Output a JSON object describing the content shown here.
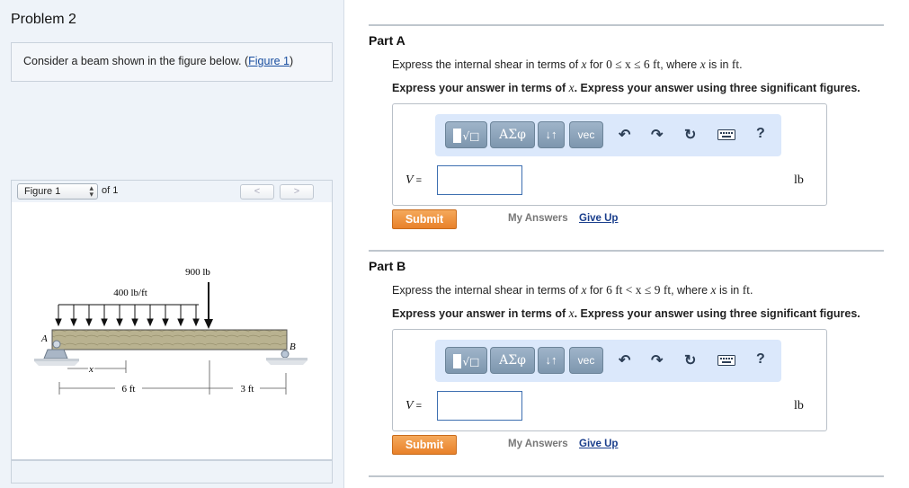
{
  "problem": {
    "title": "Problem 2",
    "prompt_text": "Consider a beam shown in the figure below. (",
    "prompt_link": "Figure 1",
    "prompt_close": ")"
  },
  "figure_nav": {
    "selected": "Figure 1",
    "of_text": "of 1",
    "prev": "<",
    "next": ">"
  },
  "figure": {
    "point_load": "900 lb",
    "dist_load": "400 lb/ft",
    "support_a": "A",
    "support_b": "B",
    "x_label": "x",
    "dim1": "6 ft",
    "dim2": "3 ft"
  },
  "toolbar": {
    "greek": "ΑΣφ",
    "arrows": "↓↑",
    "vec": "vec",
    "help": "?",
    "undo_icon": "undo-icon",
    "redo_icon": "redo-icon",
    "reset_icon": "reset-icon",
    "keyboard_icon": "keyboard-icon"
  },
  "parts": [
    {
      "title": "Part A",
      "q_pre": "Express the internal shear in terms of ",
      "q_var": "x",
      "q_mid": " for ",
      "q_range": "0 ≤ x ≤ 6 ft",
      "q_post": ", where ",
      "q_var2": "x",
      "q_post2": " is in ",
      "q_unit": "ft",
      "q_end": ".",
      "instr_pre": "Express your answer in terms of ",
      "instr_var": "x",
      "instr_post": ". Express your answer using three significant figures.",
      "var_label": "V",
      "eq": " =",
      "input_value": "",
      "unit": "lb",
      "submit": "Submit",
      "my_answers": "My Answers",
      "give_up": "Give Up"
    },
    {
      "title": "Part B",
      "q_pre": "Express the internal shear in terms of ",
      "q_var": "x",
      "q_mid": " for ",
      "q_range": "6 ft < x ≤ 9 ft",
      "q_post": ", where ",
      "q_var2": "x",
      "q_post2": " is in ",
      "q_unit": "ft",
      "q_end": ".",
      "instr_pre": "Express your answer in terms of ",
      "instr_var": "x",
      "instr_post": ". Express your answer using three significant figures.",
      "var_label": "V",
      "eq": " =",
      "input_value": "",
      "unit": "lb",
      "submit": "Submit",
      "my_answers": "My Answers",
      "give_up": "Give Up"
    }
  ]
}
